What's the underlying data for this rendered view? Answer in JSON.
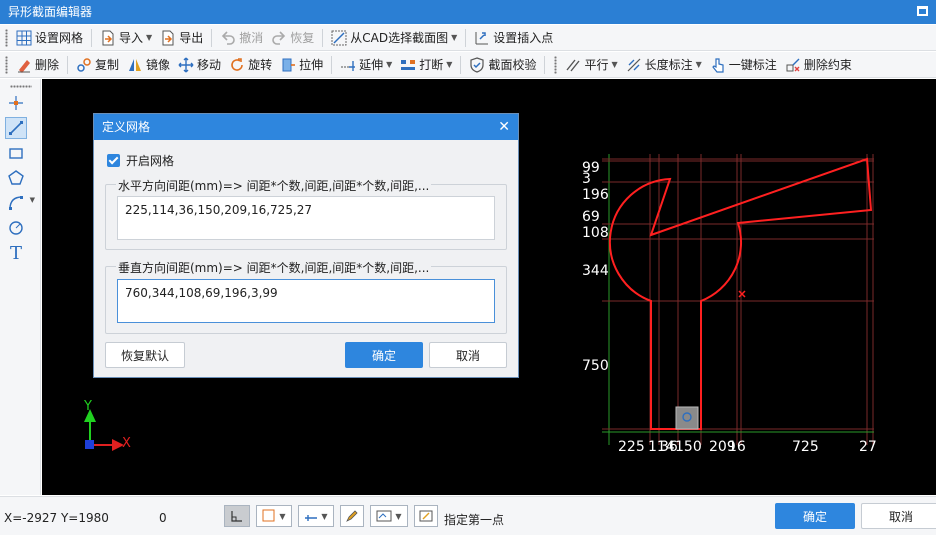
{
  "window": {
    "title": "异形截面编辑器"
  },
  "toolbar1": {
    "grid_label": "设置网格",
    "import_label": "导入",
    "export_label": "导出",
    "undo_label": "撤消",
    "redo_label": "恢复",
    "cad_label": "从CAD选择截面图",
    "insert_point_label": "设置插入点"
  },
  "toolbar2": {
    "delete_label": "删除",
    "copy_label": "复制",
    "mirror_label": "镜像",
    "move_label": "移动",
    "rotate_label": "旋转",
    "stretch_label": "拉伸",
    "extend_label": "延伸",
    "break_label": "打断",
    "check_label": "截面校验",
    "parallel_label": "平行",
    "length_dim_label": "长度标注",
    "one_click_dim_label": "一键标注",
    "delete_constraint_label": "删除约束"
  },
  "left_tools": {
    "text_tool_glyph": "T"
  },
  "canvas": {
    "horizontal_labels": [
      "225",
      "114",
      "36",
      "150",
      "209",
      "16",
      "725",
      "27"
    ],
    "vertical_labels": [
      "99",
      "3",
      "196",
      "69",
      "108",
      "344",
      "750"
    ],
    "axis_y_label": "Y",
    "axis_x_label": "X",
    "grid_color": "#2a9a2a",
    "section_color": "#ff2020",
    "grid_line_color": "#7a2a2a"
  },
  "dialog": {
    "title": "定义网格",
    "enable_grid_label": "开启网格",
    "enable_grid_checked": true,
    "horizontal_group_label": "水平方向间距(mm)=> 间距*个数,间距,间距*个数,间距,...",
    "horizontal_value": "225,114,36,150,209,16,725,27",
    "vertical_group_label": "垂直方向间距(mm)=> 间距*个数,间距,间距*个数,间距,...",
    "vertical_value": "760,344,108,69,196,3,99",
    "reset_label": "恢复默认",
    "ok_label": "确定",
    "cancel_label": "取消"
  },
  "status": {
    "coords": "X=-2927 Y=1980",
    "value": "0",
    "hint": "指定第一点",
    "ok_label": "确定",
    "cancel_label": "取消",
    "accent_color": "#2e86de"
  }
}
